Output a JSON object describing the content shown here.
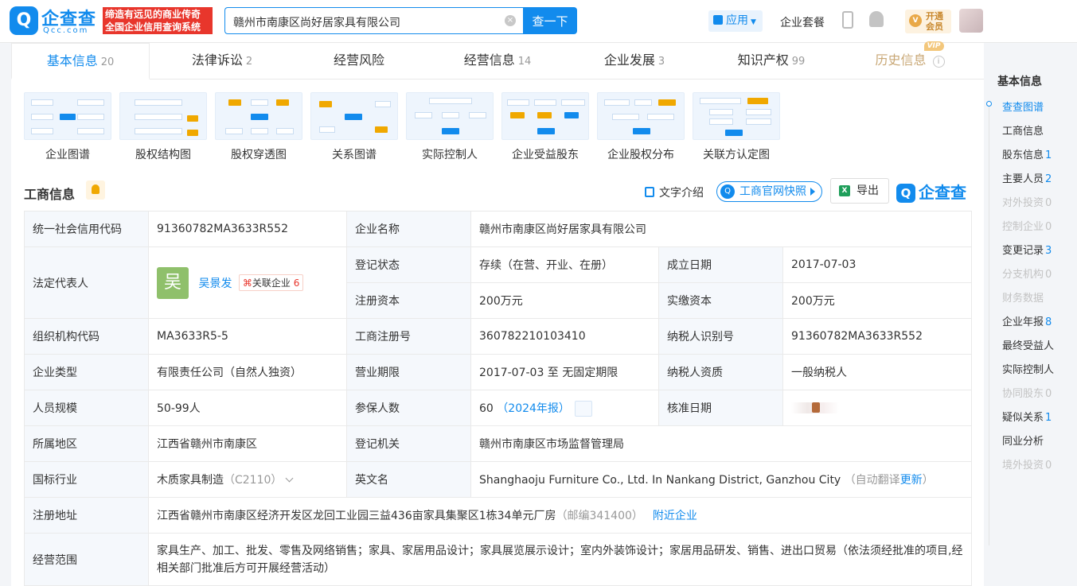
{
  "header": {
    "logo_glyph": "Q",
    "logo_text": "企查查",
    "logo_domain": "Qcc.com",
    "slogan_line1": "缔造有远见的商业传奇",
    "slogan_line2": "全国企业信用查询系统",
    "search_value": "赣州市南康区尚好居家具有限公司",
    "clear_glyph": "×",
    "search_button": "查一下",
    "app_label": "应用",
    "suite_label": "企业套餐",
    "vip_line1": "开通",
    "vip_line2": "会员",
    "vip_glyph": "V"
  },
  "tabs": [
    {
      "label": "基本信息",
      "count": "20"
    },
    {
      "label": "法律诉讼",
      "count": "2"
    },
    {
      "label": "经营风险",
      "count": ""
    },
    {
      "label": "经营信息",
      "count": "14"
    },
    {
      "label": "企业发展",
      "count": "3"
    },
    {
      "label": "知识产权",
      "count": "99"
    },
    {
      "label": "历史信息",
      "count": "",
      "tag": "VIP",
      "info_glyph": "i"
    }
  ],
  "thumbs": [
    {
      "label": "企业图谱"
    },
    {
      "label": "股权结构图"
    },
    {
      "label": "股权穿透图"
    },
    {
      "label": "关系图谱"
    },
    {
      "label": "实际控制人"
    },
    {
      "label": "企业受益股东"
    },
    {
      "label": "企业股权分布"
    },
    {
      "label": "关联方认定图"
    }
  ],
  "section": {
    "title": "工商信息",
    "intro": "文字介绍",
    "snapshot": "工商官网快照",
    "snapshot_glyph": "Q",
    "export": "导出",
    "xls_glyph": "X",
    "brand": "企查查",
    "brand_glyph": "Q"
  },
  "table": {
    "credit_code_label": "统一社会信用代码",
    "credit_code": "91360782MA3633R552",
    "name_label": "企业名称",
    "name": "赣州市南康区尚好居家具有限公司",
    "rep_label": "法定代表人",
    "rep_avatar": "吴",
    "rep_name": "吴景发",
    "rep_assoc_label": "关联企业",
    "rep_assoc_count": "6",
    "status_label": "登记状态",
    "status": "存续（在营、开业、在册）",
    "found_label": "成立日期",
    "found": "2017-07-03",
    "capital_label": "注册资本",
    "capital": "200万元",
    "paid_label": "实缴资本",
    "paid": "200万元",
    "org_code_label": "组织机构代码",
    "org_code": "MA3633R5-5",
    "reg_no_label": "工商注册号",
    "reg_no": "360782210103410",
    "tax_id_label": "纳税人识别号",
    "tax_id": "91360782MA3633R552",
    "type_label": "企业类型",
    "type": "有限责任公司（自然人独资）",
    "term_label": "营业期限",
    "term": "2017-07-03 至 无固定期限",
    "tax_qual_label": "纳税人资质",
    "tax_qual": "一般纳税人",
    "size_label": "人员规模",
    "size": "50-99人",
    "insured_label": "参保人数",
    "insured": "60",
    "insured_report": "（2024年报）",
    "approve_label": "核准日期",
    "region_label": "所属地区",
    "region": "江西省赣州市南康区",
    "authority_label": "登记机关",
    "authority": "赣州市南康区市场监督管理局",
    "industry_label": "国标行业",
    "industry": "木质家具制造",
    "industry_code": "（C2110）",
    "en_name_label": "英文名",
    "en_name": "Shanghaoju Furniture Co., Ltd. In Nankang District, Ganzhou City",
    "en_auto": "（自动翻译",
    "en_update": "更新",
    "en_close": "）",
    "address_label": "注册地址",
    "address": "江西省赣州市南康区经济开发区龙回工业园三益436亩家具集聚区1栋34单元厂房",
    "postcode": "（邮编341400）",
    "nearby": "附近企业",
    "scope_label": "经营范围",
    "scope": "家具生产、加工、批发、零售及网络销售；家具、家居用品设计；家具展览展示设计；室内外装饰设计；家居用品研发、销售、进出口贸易（依法须经批准的项目,经相关部门批准后方可开展经营活动）"
  },
  "rnav": {
    "title": "基本信息",
    "items": [
      {
        "label": "查查图谱",
        "count": "",
        "state": "active"
      },
      {
        "label": "工商信息",
        "count": "",
        "state": "normal"
      },
      {
        "label": "股东信息",
        "count": "1",
        "state": "normal"
      },
      {
        "label": "主要人员",
        "count": "2",
        "state": "normal"
      },
      {
        "label": "对外投资",
        "count": "0",
        "state": "dim"
      },
      {
        "label": "控制企业",
        "count": "0",
        "state": "dim"
      },
      {
        "label": "变更记录",
        "count": "3",
        "state": "normal"
      },
      {
        "label": "分支机构",
        "count": "0",
        "state": "dim"
      },
      {
        "label": "财务数据",
        "count": "",
        "state": "dim"
      },
      {
        "label": "企业年报",
        "count": "8",
        "state": "normal"
      },
      {
        "label": "最终受益人",
        "count": "",
        "state": "normal"
      },
      {
        "label": "实际控制人",
        "count": "",
        "state": "normal"
      },
      {
        "label": "协同股东",
        "count": "0",
        "state": "dim"
      },
      {
        "label": "疑似关系",
        "count": "1",
        "state": "normal"
      },
      {
        "label": "同业分析",
        "count": "",
        "state": "normal"
      },
      {
        "label": "境外投资",
        "count": "0",
        "state": "dim"
      }
    ]
  },
  "colors": {
    "brand": "#128bed",
    "slogan_bg": "#e8362c",
    "vip_gold": "#c8a775"
  }
}
